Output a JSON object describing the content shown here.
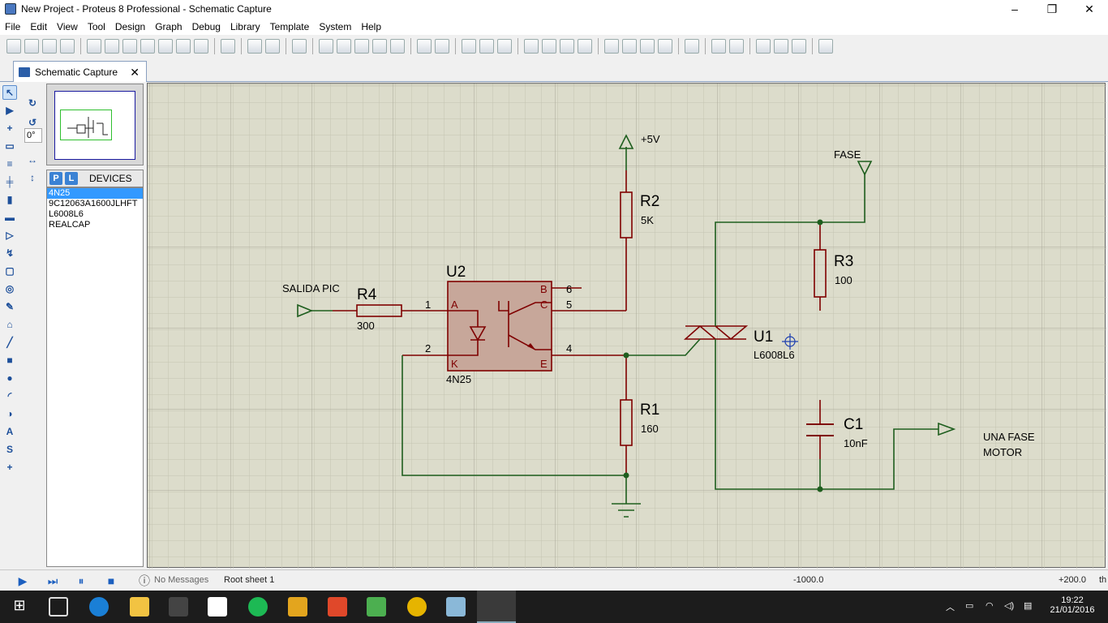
{
  "window": {
    "title": "New Project - Proteus 8 Professional - Schematic Capture",
    "controls": [
      "–",
      "❐",
      "✕"
    ]
  },
  "menu": [
    "File",
    "Edit",
    "View",
    "Tool",
    "Design",
    "Graph",
    "Debug",
    "Library",
    "Template",
    "System",
    "Help"
  ],
  "tab": {
    "label": "Schematic Capture",
    "close": "✕"
  },
  "rotation": {
    "angle": "0°"
  },
  "devices": {
    "p_button": "P",
    "l_button": "L",
    "header": "DEVICES",
    "items": [
      "4N25",
      "9C12063A1600JLHFT",
      "L6008L6",
      "REALCAP"
    ],
    "selected_index": 0
  },
  "schematic": {
    "labels": {
      "vcc": "+5V",
      "fase": "FASE",
      "salida_pic": "SALIDA PIC",
      "motor_line1": "UNA FASE",
      "motor_line2": "MOTOR"
    },
    "components": {
      "R2": {
        "ref": "R2",
        "value": "5K"
      },
      "R3": {
        "ref": "R3",
        "value": "100"
      },
      "R4": {
        "ref": "R4",
        "value": "300"
      },
      "R1": {
        "ref": "R1",
        "value": "160"
      },
      "U2": {
        "ref": "U2",
        "value": "4N25"
      },
      "U1": {
        "ref": "U1",
        "value": "L6008L6"
      },
      "C1": {
        "ref": "C1",
        "value": "10nF"
      }
    },
    "u2_pins": {
      "A": "A",
      "K": "K",
      "B": "B",
      "C": "C",
      "E": "E",
      "n1": "1",
      "n2": "2",
      "n4": "4",
      "n5": "5",
      "n6": "6"
    }
  },
  "status": {
    "messages": "No Messages",
    "sheet": "Root sheet 1",
    "coord_x": "-1000.0",
    "coord_y": "+200.0",
    "unit": "th"
  },
  "tray": {
    "time": "19:22",
    "date": "21/01/2016"
  }
}
